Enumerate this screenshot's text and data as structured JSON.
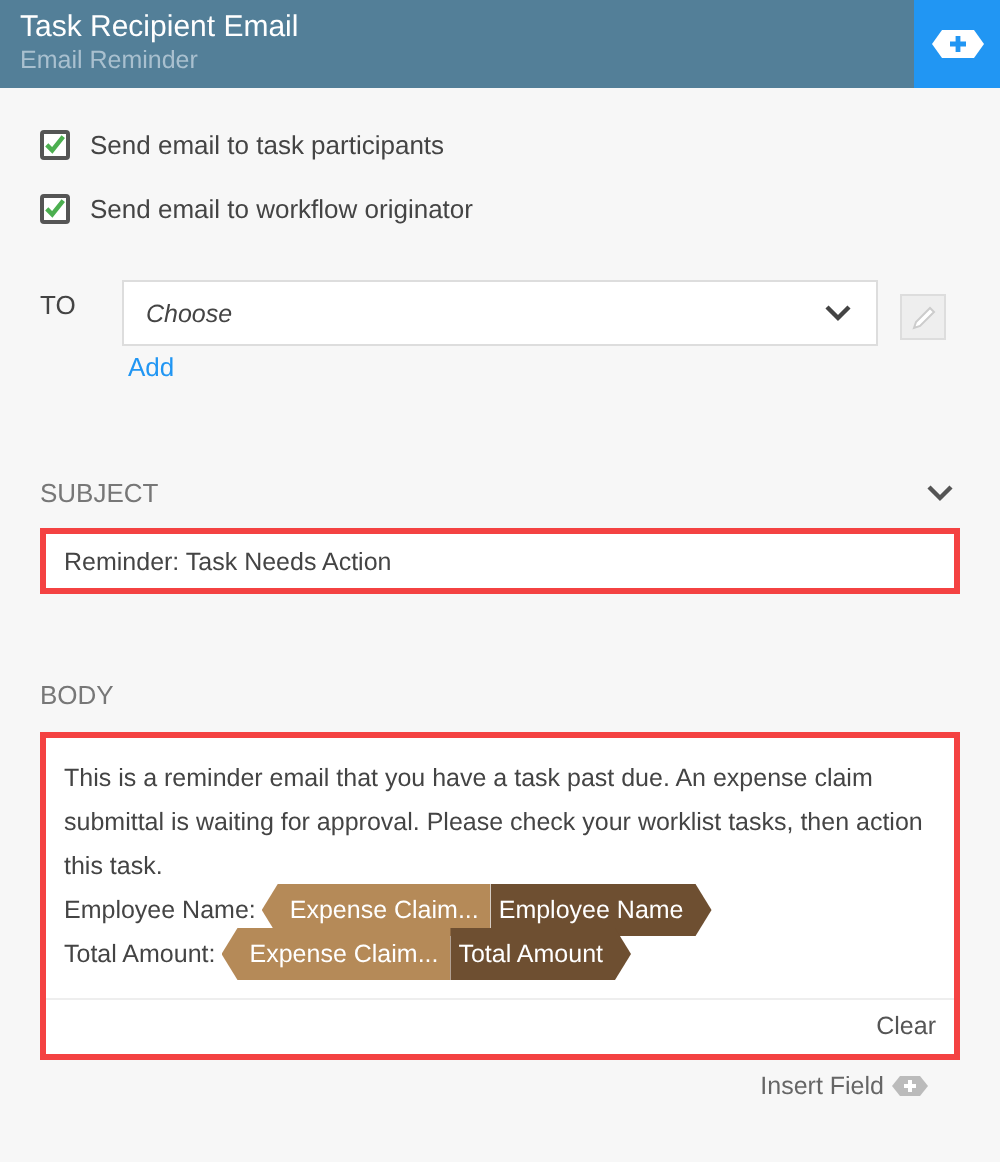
{
  "header": {
    "title": "Task Recipient Email",
    "subtitle": "Email Reminder"
  },
  "recipients": [
    {
      "label": "Send email to task participants",
      "checked": true
    },
    {
      "label": "Send email to workflow originator",
      "checked": true
    }
  ],
  "to": {
    "label": "TO",
    "placeholder": "Choose",
    "add_link": "Add"
  },
  "subject": {
    "label": "SUBJECT",
    "expanded": true,
    "value": "Reminder: Task Needs Action",
    "invalid": true
  },
  "body": {
    "label": "BODY",
    "invalid": true,
    "text": "This is a reminder email that you have a task past due. An expense claim submittal is waiting for approval. Please check your worklist tasks, then action this task.",
    "fields": [
      {
        "label": "Employee Name:",
        "source": "Expense Claim...",
        "field": "Employee Name"
      },
      {
        "label": "Total Amount:",
        "source": "Expense Claim...",
        "field": "Total Amount"
      }
    ],
    "clear": "Clear"
  },
  "insert_field": "Insert Field"
}
